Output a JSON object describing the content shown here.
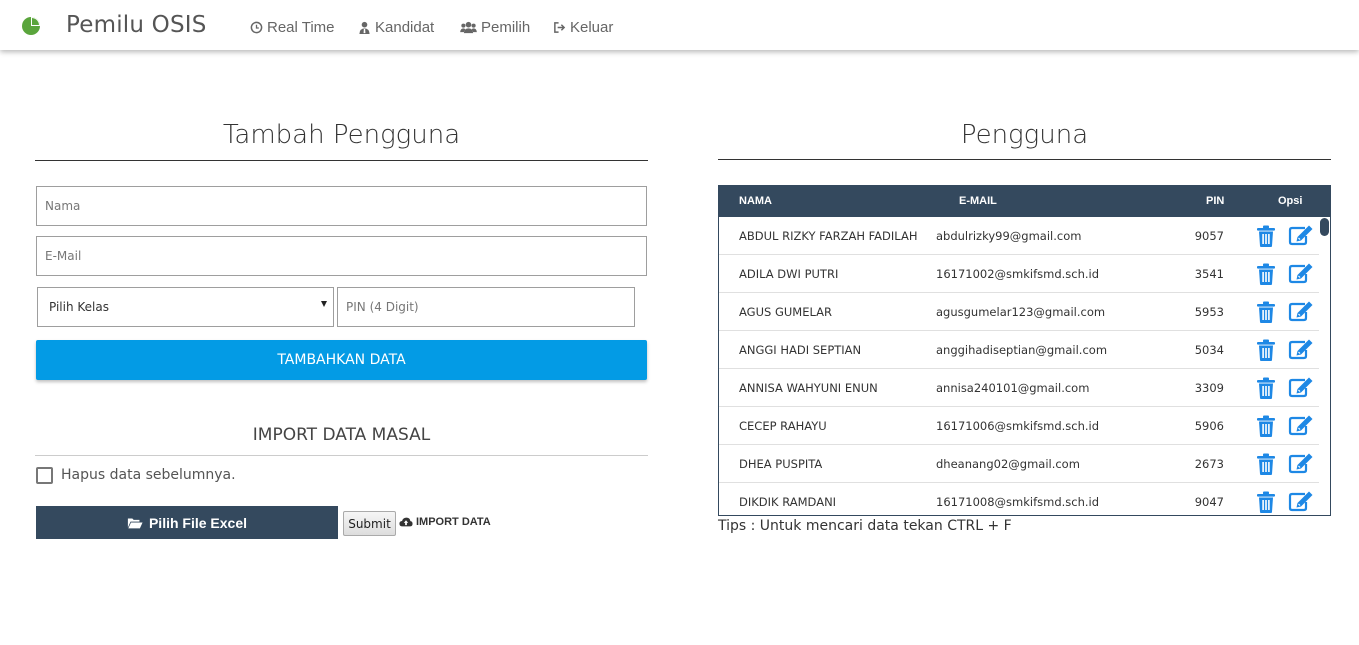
{
  "navbar": {
    "brand": "Pemilu OSIS",
    "brand_icon": "pie-chart-icon",
    "items": [
      {
        "label": "Real Time",
        "icon": "clock-icon"
      },
      {
        "label": "Kandidat",
        "icon": "user-tie-icon"
      },
      {
        "label": "Pemilih",
        "icon": "users-icon"
      },
      {
        "label": "Keluar",
        "icon": "sign-out-icon"
      }
    ]
  },
  "add_user": {
    "title": "Tambah Pengguna",
    "name_placeholder": "Nama",
    "email_placeholder": "E-Mail",
    "class_select": "Pilih Kelas",
    "pin_placeholder": "PIN (4 Digit)",
    "submit_label": "TAMBAHKAN DATA"
  },
  "import": {
    "title": "IMPORT DATA MASAL",
    "checkbox_label": "Hapus data sebelumnya.",
    "checkbox_checked": false,
    "file_button": "Pilih File Excel",
    "submit_label": "Submit",
    "import_link": "IMPORT DATA"
  },
  "users": {
    "title": "Pengguna",
    "columns": [
      "NAMA",
      "E-MAIL",
      "PIN",
      "Opsi"
    ],
    "rows": [
      {
        "name": "ABDUL RIZKY FARZAH FADILAH",
        "email": "abdulrizky99@gmail.com",
        "pin": "9057"
      },
      {
        "name": "ADILA DWI PUTRI",
        "email": "16171002@smkifsmd.sch.id",
        "pin": "3541"
      },
      {
        "name": "AGUS GUMELAR",
        "email": "agusgumelar123@gmail.com",
        "pin": "5953"
      },
      {
        "name": "ANGGI HADI SEPTIAN",
        "email": "anggihadiseptian@gmail.com",
        "pin": "5034"
      },
      {
        "name": "ANNISA WAHYUNI ENUN",
        "email": "annisa240101@gmail.com",
        "pin": "3309"
      },
      {
        "name": "CECEP RAHAYU",
        "email": "16171006@smkifsmd.sch.id",
        "pin": "5906"
      },
      {
        "name": "DHEA PUSPITA",
        "email": "dheanang02@gmail.com",
        "pin": "2673"
      },
      {
        "name": "DIKDIK RAMDANI",
        "email": "16171008@smkifsmd.sch.id",
        "pin": "9047"
      }
    ],
    "tips": "Tips : Untuk mencari data tekan CTRL + F"
  },
  "colors": {
    "navy": "#34495e",
    "primary": "#039be5",
    "icon_blue": "#1e88e5",
    "brand_green": "#5aa53c"
  }
}
